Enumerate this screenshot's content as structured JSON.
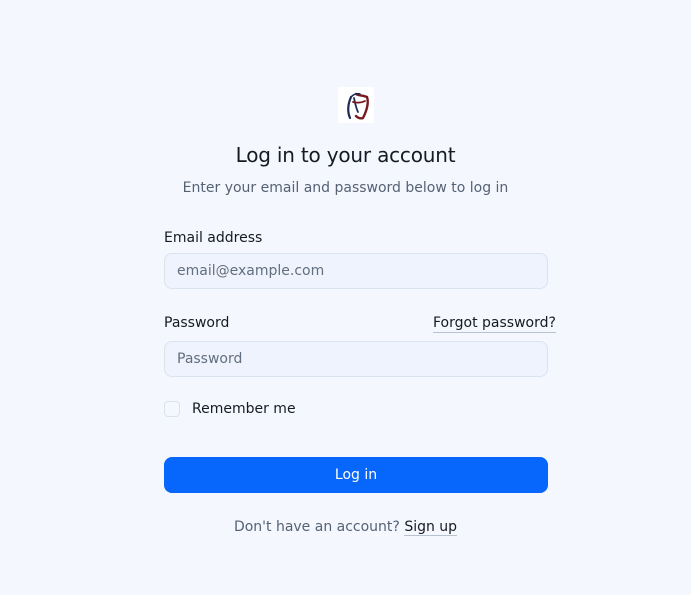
{
  "brand": {
    "logo_icon": "shopping-bag-logo-icon",
    "colors": {
      "logo_dark": "#1e2a56",
      "logo_red": "#761a1f"
    }
  },
  "login": {
    "title": "Log in to your account",
    "subtitle": "Enter your email and password below to log in",
    "email": {
      "label": "Email address",
      "placeholder": "email@example.com",
      "value": ""
    },
    "password": {
      "label": "Password",
      "placeholder": "Password",
      "value": ""
    },
    "forgot_password": "Forgot password?",
    "remember_me": "Remember me",
    "submit_label": "Log in",
    "signup_prompt": "Don't have an account?",
    "signup_link": "Sign up"
  },
  "theme": {
    "background": "#f4f7fe",
    "primary": "#0766fb",
    "text": "#151a24",
    "muted_text": "#556274"
  }
}
